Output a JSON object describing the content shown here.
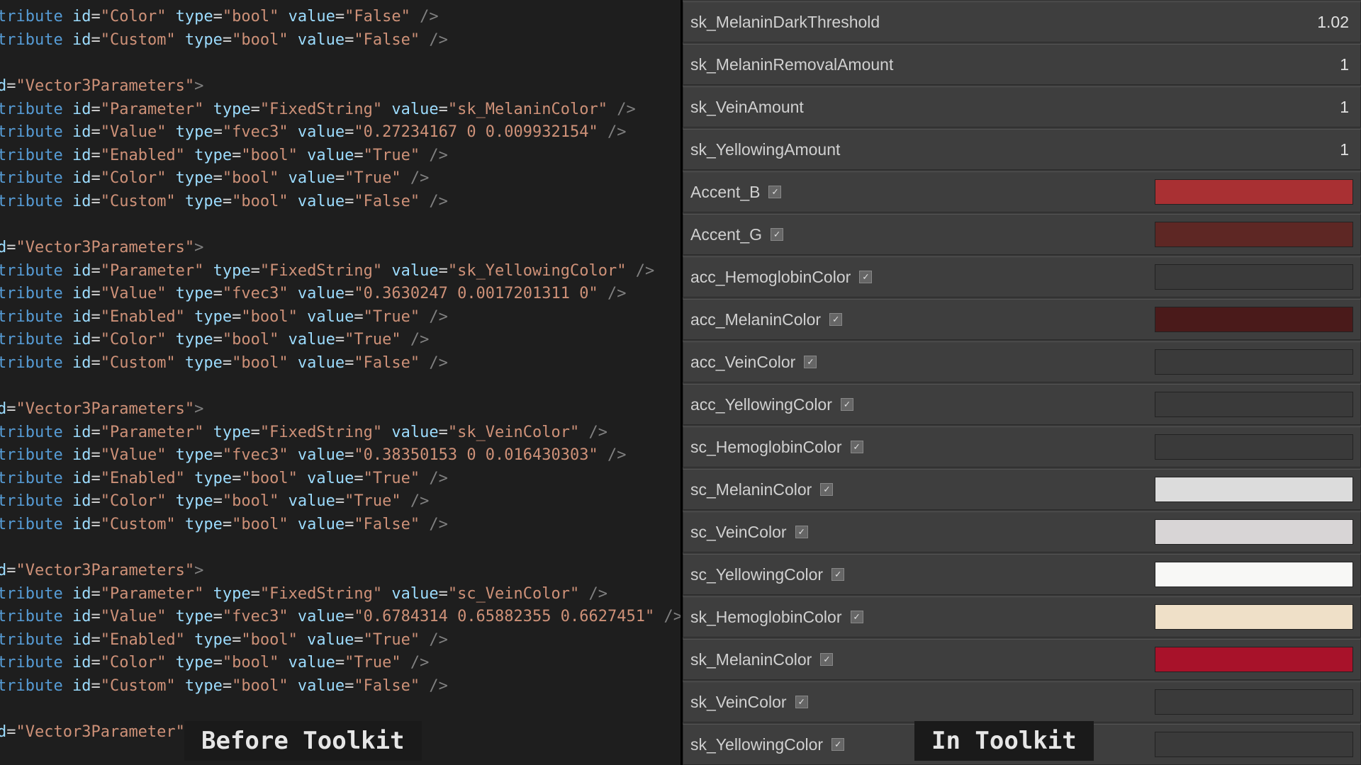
{
  "labels": {
    "left": "Before Toolkit",
    "right": "In Toolkit"
  },
  "code": {
    "blocks": [
      {
        "header": null,
        "attrs": [
          {
            "id": "Color",
            "type": "bool",
            "value": "False"
          },
          {
            "id": "Custom",
            "type": "bool",
            "value": "False"
          }
        ]
      },
      {
        "header": "Vector3Parameters",
        "attrs": [
          {
            "id": "Parameter",
            "type": "FixedString",
            "value": "sk_MelaninColor"
          },
          {
            "id": "Value",
            "type": "fvec3",
            "value": "0.27234167 0 0.009932154"
          },
          {
            "id": "Enabled",
            "type": "bool",
            "value": "True"
          },
          {
            "id": "Color",
            "type": "bool",
            "value": "True"
          },
          {
            "id": "Custom",
            "type": "bool",
            "value": "False"
          }
        ]
      },
      {
        "header": "Vector3Parameters",
        "attrs": [
          {
            "id": "Parameter",
            "type": "FixedString",
            "value": "sk_YellowingColor"
          },
          {
            "id": "Value",
            "type": "fvec3",
            "value": "0.3630247 0.0017201311 0"
          },
          {
            "id": "Enabled",
            "type": "bool",
            "value": "True"
          },
          {
            "id": "Color",
            "type": "bool",
            "value": "True"
          },
          {
            "id": "Custom",
            "type": "bool",
            "value": "False"
          }
        ]
      },
      {
        "header": "Vector3Parameters",
        "attrs": [
          {
            "id": "Parameter",
            "type": "FixedString",
            "value": "sk_VeinColor"
          },
          {
            "id": "Value",
            "type": "fvec3",
            "value": "0.38350153 0 0.016430303"
          },
          {
            "id": "Enabled",
            "type": "bool",
            "value": "True"
          },
          {
            "id": "Color",
            "type": "bool",
            "value": "True"
          },
          {
            "id": "Custom",
            "type": "bool",
            "value": "False"
          }
        ]
      },
      {
        "header": "Vector3Parameters",
        "attrs": [
          {
            "id": "Parameter",
            "type": "FixedString",
            "value": "sc_VeinColor"
          },
          {
            "id": "Value",
            "type": "fvec3",
            "value": "0.6784314 0.65882355 0.6627451"
          },
          {
            "id": "Enabled",
            "type": "bool",
            "value": "True"
          },
          {
            "id": "Color",
            "type": "bool",
            "value": "True"
          },
          {
            "id": "Custom",
            "type": "bool",
            "value": "False"
          }
        ]
      },
      {
        "header": "Vector3Parameter",
        "attrs": []
      }
    ]
  },
  "props": {
    "scalars": [
      {
        "name": "sk_MelaninDarkThreshold",
        "value": "1.02"
      },
      {
        "name": "sk_MelaninRemovalAmount",
        "value": "1"
      },
      {
        "name": "sk_VeinAmount",
        "value": "1"
      },
      {
        "name": "sk_YellowingAmount",
        "value": "1"
      }
    ],
    "colors": [
      {
        "name": "Accent_B",
        "checked": true,
        "color": "#a93033"
      },
      {
        "name": "Accent_G",
        "checked": true,
        "color": "#5e2724"
      },
      {
        "name": "acc_HemoglobinColor",
        "checked": true,
        "color": "#3a3a3a"
      },
      {
        "name": "acc_MelaninColor",
        "checked": true,
        "color": "#4a1a1a"
      },
      {
        "name": "acc_VeinColor",
        "checked": true,
        "color": "#3a3a3a"
      },
      {
        "name": "acc_YellowingColor",
        "checked": true,
        "color": "#3a3a3a"
      },
      {
        "name": "sc_HemoglobinColor",
        "checked": true,
        "color": "#3a3a3a"
      },
      {
        "name": "sc_MelaninColor",
        "checked": true,
        "color": "#dcdcdc"
      },
      {
        "name": "sc_VeinColor",
        "checked": true,
        "color": "#d8d5d6"
      },
      {
        "name": "sc_YellowingColor",
        "checked": true,
        "color": "#f8f8f6"
      },
      {
        "name": "sk_HemoglobinColor",
        "checked": true,
        "color": "#efe0c8"
      },
      {
        "name": "sk_MelaninColor",
        "checked": true,
        "color": "#a8122a"
      },
      {
        "name": "sk_VeinColor",
        "checked": true,
        "color": "#3a3a3a"
      },
      {
        "name": "sk_YellowingColor",
        "checked": true,
        "color": "#3a3a3a"
      }
    ]
  }
}
